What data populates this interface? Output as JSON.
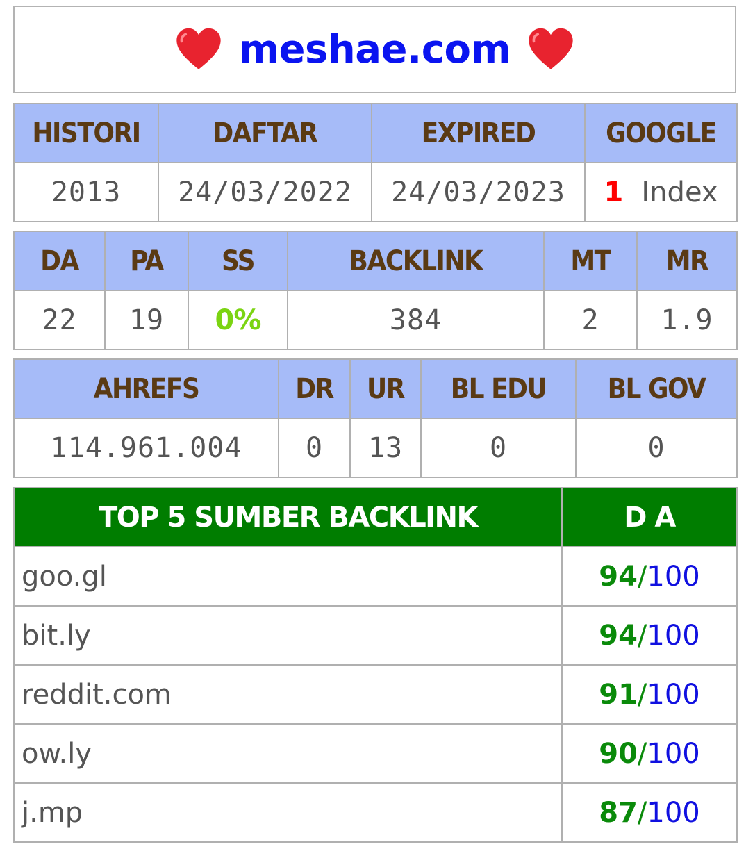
{
  "site": {
    "domain": "meshae.com",
    "left_icon": "heart-icon",
    "right_icon": "heart-icon",
    "accent_color": "#0a14f0"
  },
  "info_table": {
    "headers": [
      "HISTORI",
      "DAFTAR",
      "EXPIRED",
      "GOOGLE"
    ],
    "histori": "2013",
    "daftar": "24/03/2022",
    "expired": "24/03/2023",
    "google_count": "1",
    "google_label": "Index"
  },
  "moz_table": {
    "headers": [
      "DA",
      "PA",
      "SS",
      "BACKLINK",
      "MT",
      "MR"
    ],
    "da": "22",
    "pa": "19",
    "ss": "0%",
    "backlink": "384",
    "mt": "2",
    "mr": "1.9"
  },
  "ahrefs_table": {
    "headers": [
      "AHREFS",
      "DR",
      "UR",
      "BL EDU",
      "BL GOV"
    ],
    "ahrefs": "114.961.004",
    "dr": "0",
    "ur": "13",
    "bl_edu": "0",
    "bl_gov": "0"
  },
  "top_backlinks": {
    "header_source": "TOP 5 SUMBER BACKLINK",
    "header_da": "D A",
    "max_label": "100",
    "slash": "/",
    "rows": [
      {
        "domain": "goo.gl",
        "da": "94"
      },
      {
        "domain": "bit.ly",
        "da": "94"
      },
      {
        "domain": "reddit.com",
        "da": "91"
      },
      {
        "domain": "ow.ly",
        "da": "90"
      },
      {
        "domain": "j.mp",
        "da": "87"
      }
    ]
  },
  "colors": {
    "header_bg": "#a6bbf8",
    "header_text": "#5a3a14",
    "top_header_bg": "#007d00",
    "ss_green": "#7bd412",
    "google_red": "#ff0000",
    "da_green": "#0a8a0a",
    "da_blue": "#1010e0"
  }
}
